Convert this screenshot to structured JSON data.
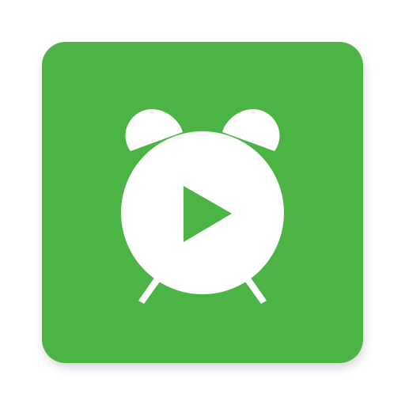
{
  "app_icon": {
    "icon_name": "alarm-clock-play-icon",
    "colors": {
      "background": "#4cb345",
      "foreground": "#ffffff",
      "play_triangle": "#4cb345"
    }
  }
}
